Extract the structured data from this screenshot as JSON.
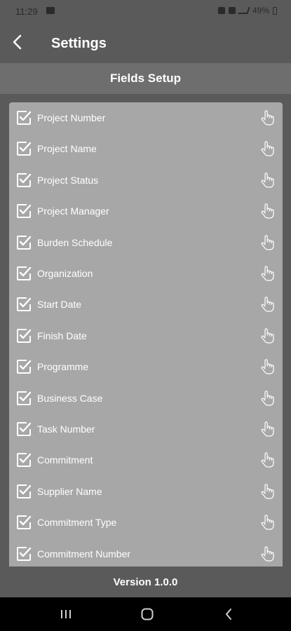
{
  "status_bar": {
    "time": "11:29",
    "battery": "49%"
  },
  "header": {
    "title": "Settings",
    "back_icon": "chevron-left-icon"
  },
  "section": {
    "title": "Fields Setup"
  },
  "fields": [
    {
      "label": "Project Number",
      "checked": true
    },
    {
      "label": "Project Name",
      "checked": true
    },
    {
      "label": "Project Status",
      "checked": true
    },
    {
      "label": "Project Manager",
      "checked": true
    },
    {
      "label": "Burden Schedule",
      "checked": true
    },
    {
      "label": "Organization",
      "checked": true
    },
    {
      "label": "Start Date",
      "checked": true
    },
    {
      "label": "Finish Date",
      "checked": true
    },
    {
      "label": "Programme",
      "checked": true
    },
    {
      "label": "Business Case",
      "checked": true
    },
    {
      "label": "Task Number",
      "checked": true
    },
    {
      "label": "Commitment",
      "checked": true
    },
    {
      "label": "Supplier Name",
      "checked": true
    },
    {
      "label": "Commitment Type",
      "checked": true
    },
    {
      "label": "Commitment Number",
      "checked": true
    }
  ],
  "footer": {
    "version": "Version 1.0.0"
  },
  "colors": {
    "background": "#5a5a5a",
    "section_header": "#6e6e6e",
    "panel": "#a7a7a7",
    "nav_bar": "#000000"
  }
}
